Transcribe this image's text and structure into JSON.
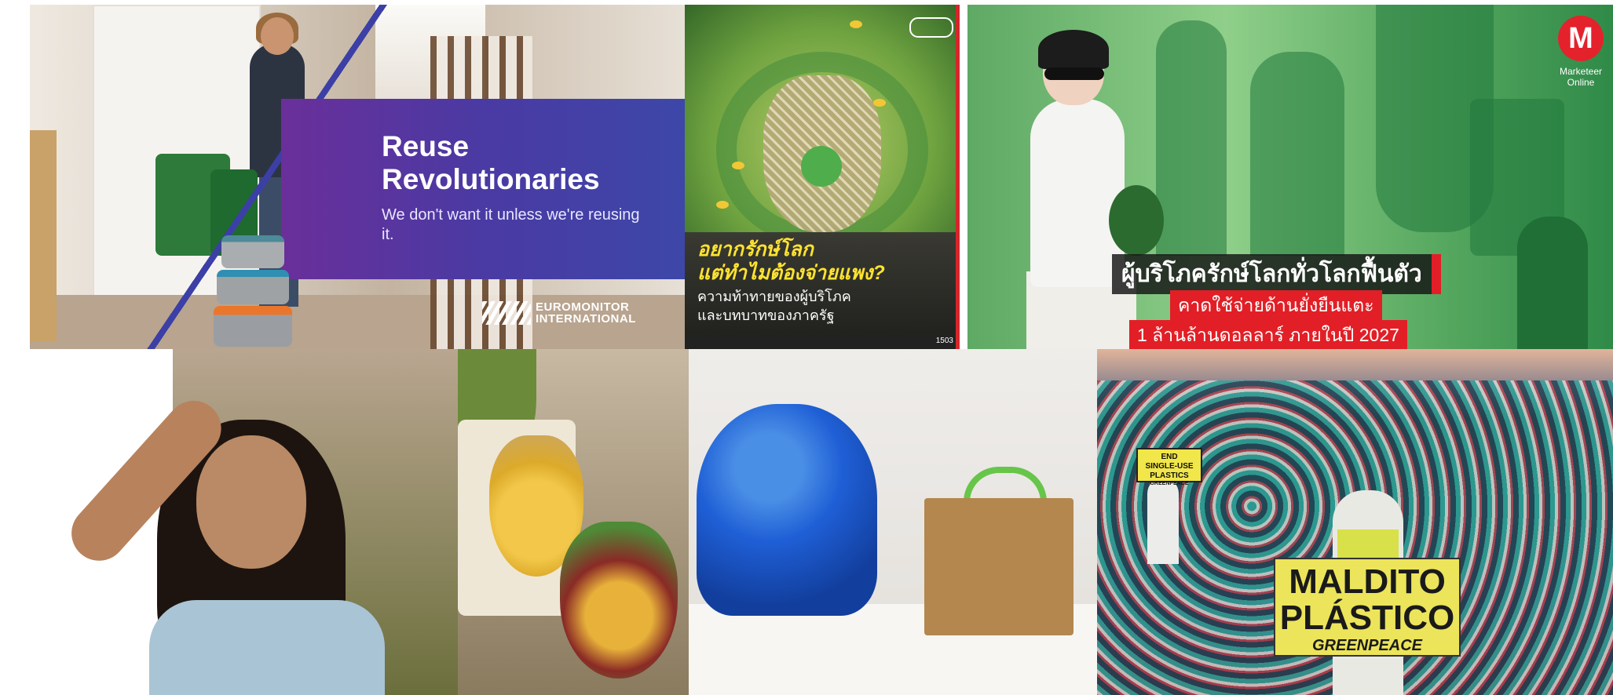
{
  "tiles": {
    "euromonitor": {
      "headline_line1": "Reuse",
      "headline_line2": "Revolutionaries",
      "subline": "We don't want it unless we're reusing it.",
      "brand_line1": "EUROMONITOR",
      "brand_line2": "INTERNATIONAL",
      "panel_color": "#4a3aa3"
    },
    "thai_poster": {
      "title_line1": "อยากรักษ์โลก",
      "title_line2": "แต่ทำไมต้องจ่ายแพง?",
      "sub_line1": "ความท้าทายของผู้บริโภค",
      "sub_line2": "และบทบาทของภาครัฐ",
      "page_number": "1503",
      "title_color": "#ffe330"
    },
    "marketeer": {
      "logo_letter": "M",
      "logo_text_line1": "Marketeer",
      "logo_text_line2": "Online",
      "headline1": "ผู้บริโภครักษ์โลกทั่วโลกฟื้นตัว",
      "headline2": "คาดใช้จ่ายด้านยั่งยืนแตะ",
      "headline3": "1 ล้านล้านดอลลาร์ ภายในปี 2027",
      "accent_color": "#e21f26"
    },
    "greenpeace": {
      "small_sign_line1": "END",
      "small_sign_line2": "SINGLE-USE",
      "small_sign_line3": "PLASTICS",
      "small_sign_line4": "GREENPEACE",
      "big_sign_line1": "MALDITO",
      "big_sign_line2": "PLÁSTICO",
      "big_sign_line3": "GREENPEACE",
      "sign_color": "#ece45a"
    }
  }
}
